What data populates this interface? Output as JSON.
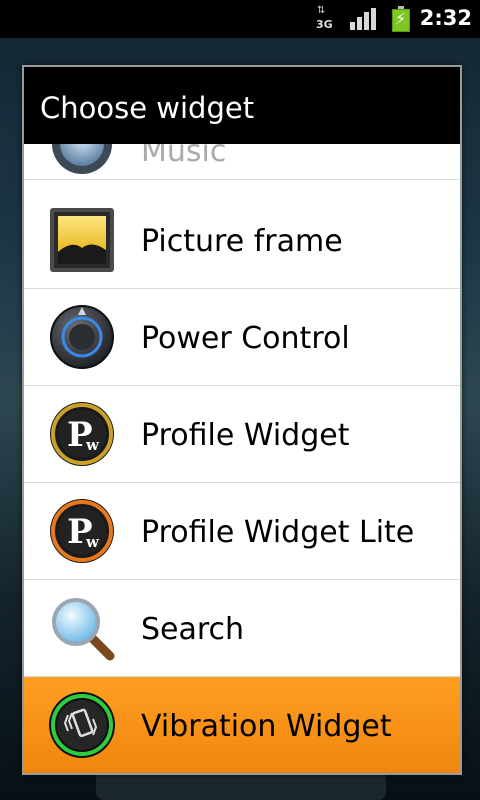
{
  "status_bar": {
    "network_type": "3G",
    "time": "2:32"
  },
  "dialog": {
    "title": "Choose widget",
    "items": [
      {
        "label": "Music",
        "icon": "music-icon",
        "partial": true
      },
      {
        "label": "Picture frame",
        "icon": "picture-frame-icon"
      },
      {
        "label": "Power Control",
        "icon": "power-control-icon"
      },
      {
        "label": "Profile Widget",
        "icon": "profile-widget-icon"
      },
      {
        "label": "Profile Widget Lite",
        "icon": "profile-widget-lite-icon"
      },
      {
        "label": "Search",
        "icon": "search-icon"
      },
      {
        "label": "Vibration Widget",
        "icon": "vibration-widget-icon",
        "selected": true
      }
    ]
  },
  "colors": {
    "selection": "#f0860d",
    "battery": "#7ec622",
    "profile_gold": "#c9a227",
    "profile_lite_orange": "#e8781c",
    "vibration_green": "#2ecc40"
  }
}
